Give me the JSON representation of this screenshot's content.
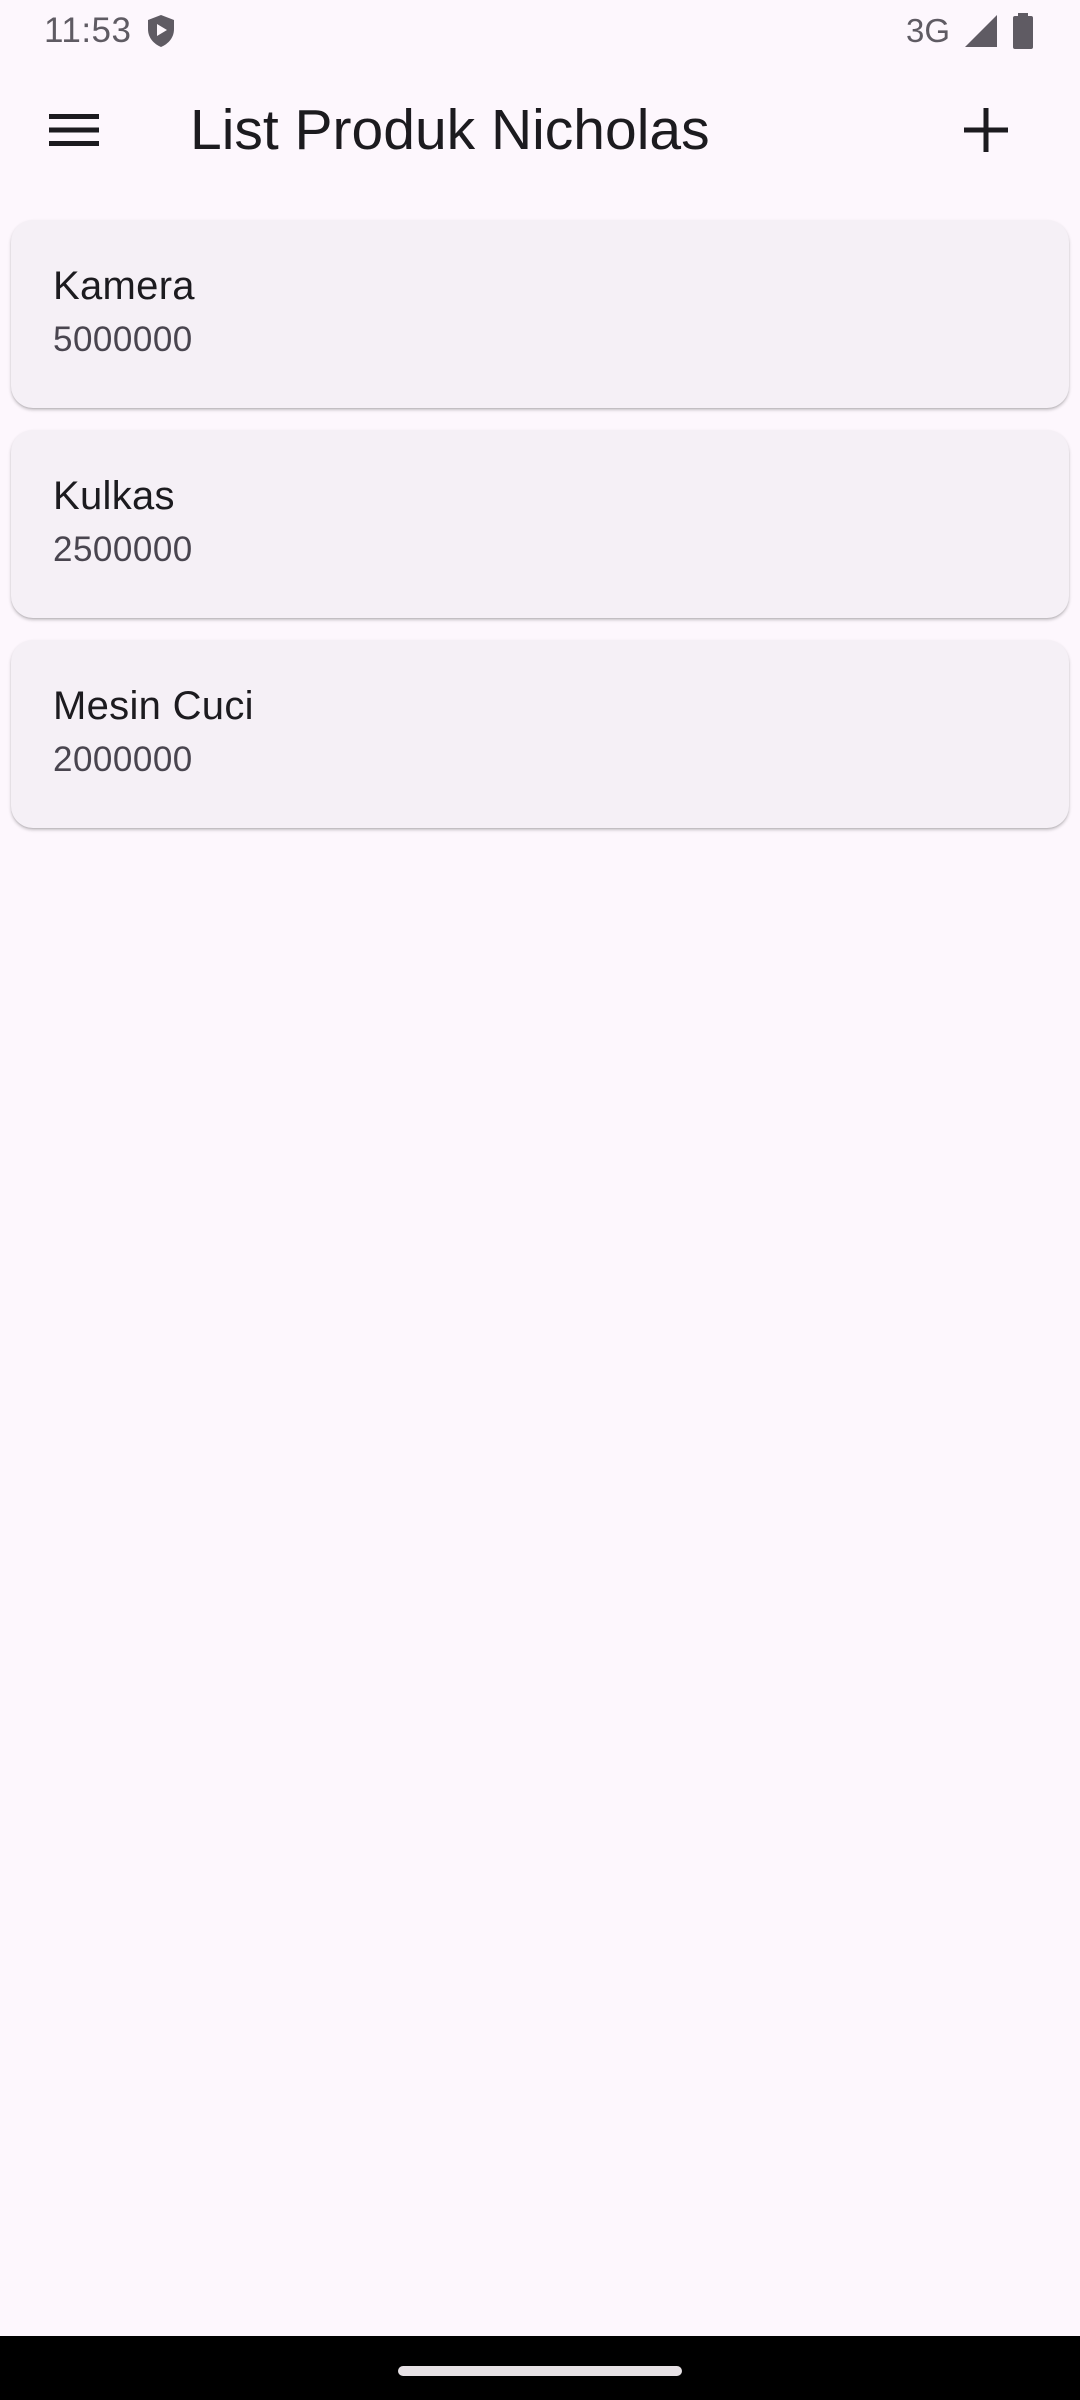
{
  "status_bar": {
    "time": "11:53",
    "network": "3G",
    "icons": [
      "shield-icon",
      "signal-icon",
      "battery-icon"
    ]
  },
  "app_bar": {
    "title": "List Produk Nicholas",
    "menu_icon": "menu-icon",
    "add_icon": "add-icon"
  },
  "products": [
    {
      "name": "Kamera",
      "price": "5000000"
    },
    {
      "name": "Kulkas",
      "price": "2500000"
    },
    {
      "name": "Mesin Cuci",
      "price": "2000000"
    }
  ],
  "colors": {
    "background": "#fdf7fd",
    "card": "#f5f0f6",
    "text_primary": "#1c1b1f",
    "text_secondary": "#49454f"
  }
}
